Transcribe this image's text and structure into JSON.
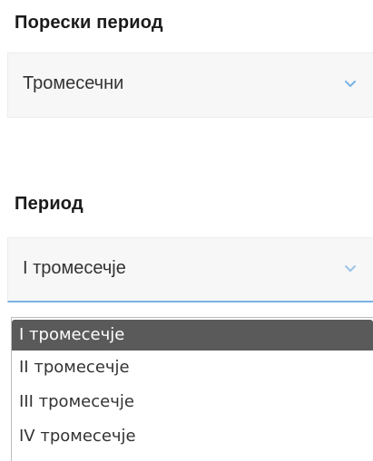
{
  "tax_period": {
    "label": "Порески период",
    "value": "Тромесечни"
  },
  "period": {
    "label": "Период",
    "value": "I тромесечје",
    "options": [
      {
        "label": "I тромесечје",
        "selected": true
      },
      {
        "label": "II тромесечје",
        "selected": false
      },
      {
        "label": "III тромесечје",
        "selected": false
      },
      {
        "label": "IV тромесечје",
        "selected": false
      }
    ]
  },
  "colors": {
    "chevron": "#7ab3e6",
    "focus_underline": "#7ab3e6",
    "selected_option_bg": "#5a5a5a"
  }
}
